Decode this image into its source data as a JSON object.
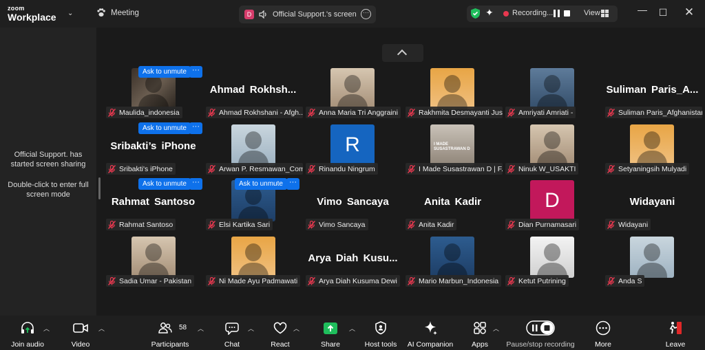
{
  "app": {
    "brand_top": "zoom",
    "brand_bottom": "Workplace"
  },
  "header": {
    "meeting_label": "Meeting",
    "share_title": "Official Support.'s screen",
    "share_avatar_letter": "D",
    "recording_text": "Recording...",
    "view_label": "View"
  },
  "sidebar": {
    "share_notice": "Official Support. has started screen sharing",
    "fullscreen_hint": "Double-click to enter full screen mode"
  },
  "participants": [
    {
      "label": "Maulida_indonesia",
      "display": "photo",
      "unmute": true
    },
    {
      "label": "Ahmad Rokhshani - Afgh...",
      "display": "name",
      "bigname": "Ahmad Rokhsh..."
    },
    {
      "label": "Anna Maria Tri Anggraini",
      "display": "photo"
    },
    {
      "label": "Rakhmita Desmayanti Jus...",
      "display": "photo"
    },
    {
      "label": "Amriyati Amriati -",
      "display": "photo"
    },
    {
      "label": "Suliman Paris_Afghanistan",
      "display": "name",
      "bigname": "Suliman Paris_A..."
    },
    {
      "label": "Sribakti's iPhone",
      "display": "name",
      "bigname": "Sribakti’s iPhone",
      "unmute": true
    },
    {
      "label": "Arwan P. Resmawan_Com...",
      "display": "photo"
    },
    {
      "label": "Rinandu Ningrum",
      "display": "letter",
      "letter": "R",
      "color": "#1565c0"
    },
    {
      "label": "I Made Susastrawan D | F...",
      "display": "photo",
      "photo_text": "I MADE SUSASTRAWAN D"
    },
    {
      "label": "Ninuk W_USAKTI",
      "display": "photo"
    },
    {
      "label": "Setyaningsih Mulyadi",
      "display": "photo"
    },
    {
      "label": "Rahmat Santoso",
      "display": "name",
      "bigname": "Rahmat Santoso",
      "unmute": true
    },
    {
      "label": "Elsi Kartika Sari",
      "display": "photo",
      "unmute": true
    },
    {
      "label": "Vimo Sancaya",
      "display": "name",
      "bigname": "Vimo Sancaya"
    },
    {
      "label": "Anita Kadir",
      "display": "name",
      "bigname": "Anita Kadir"
    },
    {
      "label": "Dian Purnamasari",
      "display": "letter",
      "letter": "D",
      "color": "#c2185b"
    },
    {
      "label": "Widayani",
      "display": "name",
      "bigname": "Widayani"
    },
    {
      "label": "Sadia Umar - Pakistan",
      "display": "photo"
    },
    {
      "label": "Ni Made Ayu Padmawati",
      "display": "photo"
    },
    {
      "label": "Arya Diah Kusuma Dewi",
      "display": "name",
      "bigname": "Arya Diah Kusu..."
    },
    {
      "label": "Mario Marbun_Indonesia",
      "display": "photo"
    },
    {
      "label": "Ketut Putrining",
      "display": "photo"
    },
    {
      "label": "Anda S",
      "display": "photo"
    }
  ],
  "ask_unmute_label": "Ask to unmute",
  "more_label": "···",
  "toolbar": {
    "join_audio": "Join audio",
    "video": "Video",
    "participants": "Participants",
    "participants_count": "58",
    "chat": "Chat",
    "react": "React",
    "share": "Share",
    "host_tools": "Host tools",
    "ai_companion": "AI Companion",
    "apps": "Apps",
    "pause_stop": "Pause/stop recording",
    "more": "More",
    "leave": "Leave"
  },
  "colors": {
    "accent": "#0e71eb",
    "share_green": "#1fbe5c",
    "record_red": "#e8384f",
    "leave_red": "#e02828"
  }
}
